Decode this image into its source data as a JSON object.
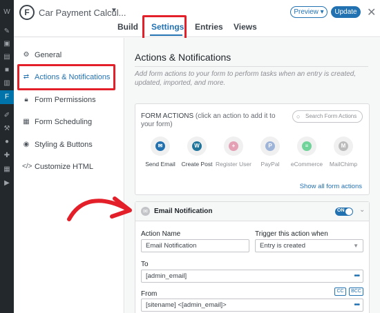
{
  "header": {
    "form_title": "Car Payment Calcul...",
    "preview_label": "Preview ▾",
    "update_label": "Update",
    "tabs": [
      "Build",
      "Settings",
      "Entries",
      "Views"
    ],
    "active_tab": "Settings"
  },
  "settings_nav": {
    "items": [
      {
        "label": "General",
        "icon": "gear-icon"
      },
      {
        "label": "Actions & Notifications",
        "icon": "actions-icon"
      },
      {
        "label": "Form Permissions",
        "icon": "lock-icon"
      },
      {
        "label": "Form Scheduling",
        "icon": "calendar-icon"
      },
      {
        "label": "Styling & Buttons",
        "icon": "palette-icon"
      },
      {
        "label": "Customize HTML",
        "icon": "code-icon"
      }
    ],
    "active_item": "Actions & Notifications"
  },
  "main": {
    "title": "Actions & Notifications",
    "description": "Add form actions to your form to perform tasks when an entry is created, updated, imported, and more.",
    "form_actions": {
      "heading": "FORM ACTIONS",
      "hint": "(click an action to add it to your form)",
      "search_placeholder": "Search Form Actions",
      "actions": [
        {
          "label": "Send Email",
          "icon": "email-icon",
          "enabled": true,
          "color": "#2271b1"
        },
        {
          "label": "Create Post",
          "icon": "wordpress-icon",
          "enabled": true,
          "color": "#21759b"
        },
        {
          "label": "Register User",
          "icon": "user-plus-icon",
          "enabled": false,
          "color": "#e4a1b6"
        },
        {
          "label": "PayPal",
          "icon": "paypal-icon",
          "enabled": false,
          "color": "#9fb4d9"
        },
        {
          "label": "eCommerce",
          "icon": "ecommerce-icon",
          "enabled": false,
          "color": "#6fd39a"
        },
        {
          "label": "MailChimp",
          "icon": "mailchimp-icon",
          "enabled": false,
          "color": "#bcbcbc"
        }
      ],
      "show_all_label": "Show all form actions"
    },
    "email_notification": {
      "title": "Email Notification",
      "toggle_label": "ON",
      "action_name_label": "Action Name",
      "action_name_value": "Email Notification",
      "trigger_label": "Trigger this action when",
      "trigger_value": "Entry is created",
      "to_label": "To",
      "to_value": "[admin_email]",
      "from_label": "From",
      "from_value": "[sitename] <[admin_email]>",
      "cc_label": "CC",
      "bcc_label": "BCC"
    }
  },
  "colors": {
    "accent": "#2271b1",
    "highlight": "#e3202a",
    "admin_bar": "#23282d"
  }
}
